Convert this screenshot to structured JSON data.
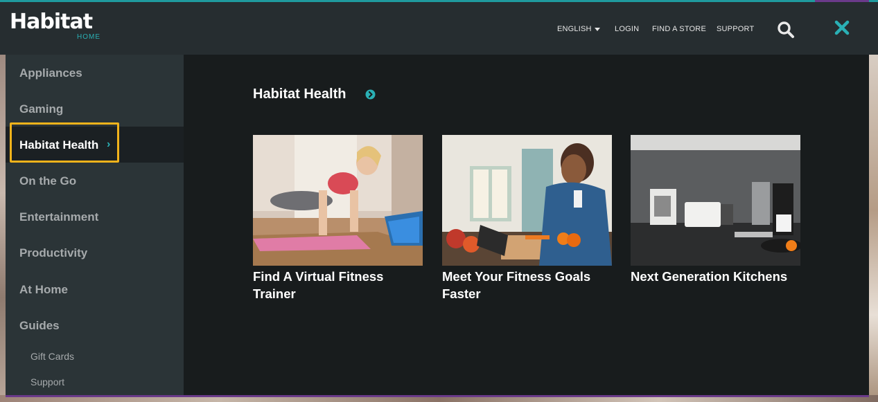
{
  "brand": {
    "name": "Habitat",
    "sub": "HOME"
  },
  "header": {
    "language": "ENGLISH",
    "login": "LOGIN",
    "find_store": "FIND A STORE",
    "support": "SUPPORT",
    "search_icon": "search-icon",
    "close_icon": "close-icon",
    "accent_color": "#2ab0b5"
  },
  "sidebar": {
    "items": [
      {
        "label": "Appliances"
      },
      {
        "label": "Gaming"
      },
      {
        "label": "Habitat Health",
        "active": true
      },
      {
        "label": "On the Go"
      },
      {
        "label": "Entertainment"
      },
      {
        "label": "Productivity"
      },
      {
        "label": "At Home"
      },
      {
        "label": "Guides"
      }
    ],
    "sub_items": [
      {
        "label": "Gift Cards"
      },
      {
        "label": "Support"
      }
    ],
    "focus_color": "#f2b31b"
  },
  "main": {
    "title": "Habitat Health",
    "cards": [
      {
        "title": "Find A Virtual Fitness Trainer",
        "image": "woman doing plank with tablet"
      },
      {
        "title": "Meet Your Fitness Goals Faster",
        "image": "woman chopping vegetables with tablet"
      },
      {
        "title": "Next Generation Kitchens",
        "image": "modern kitchen appliances"
      }
    ]
  }
}
